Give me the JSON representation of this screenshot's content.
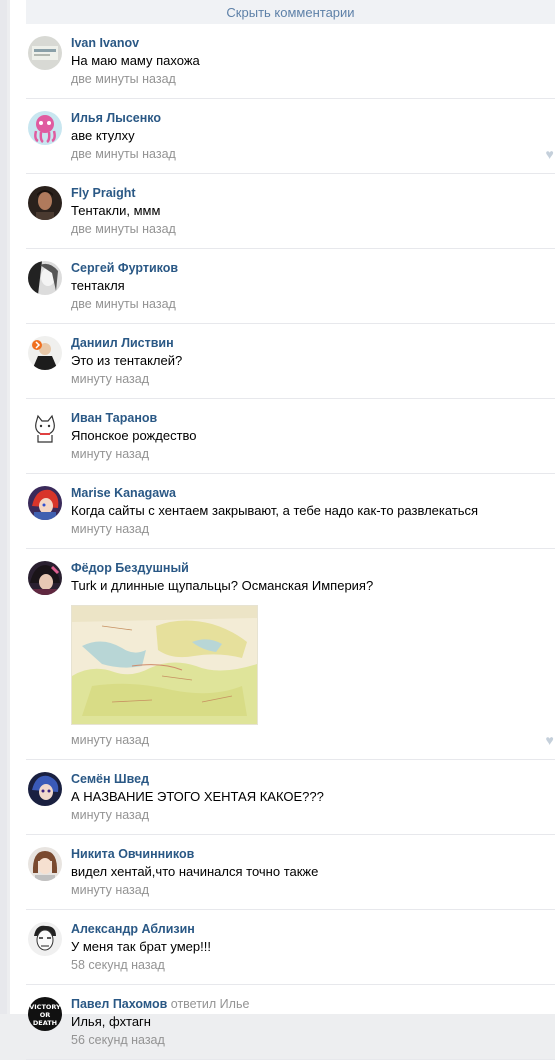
{
  "hide_comments": "Скрыть комментарии",
  "comments": [
    {
      "author": "Ivan Ivanov",
      "reply": "",
      "text": "На маю маму пахожа",
      "date": "две минуты назад",
      "likes": "",
      "avatar": "grey"
    },
    {
      "author": "Илья Лысенко",
      "reply": "",
      "text": "аве ктулху",
      "date": "две минуты назад",
      "likes": "1",
      "avatar": "octopus"
    },
    {
      "author": "Fly Praight",
      "reply": "",
      "text": "Тентакли, ммм",
      "date": "две минуты назад",
      "likes": "",
      "avatar": "dark"
    },
    {
      "author": "Сергей Фуртиков",
      "reply": "",
      "text": "тентакля",
      "date": "две минуты назад",
      "likes": "",
      "avatar": "bw"
    },
    {
      "author": "Даниил Листвин",
      "reply": "",
      "text": "Это из тентаклей?",
      "date": "минуту назад",
      "likes": "",
      "avatar": "suit"
    },
    {
      "author": "Иван Таранов",
      "reply": "",
      "text": "Японское рождество",
      "date": "минуту назад",
      "likes": "",
      "avatar": "cat"
    },
    {
      "author": "Marise Kanagawa",
      "reply": "",
      "text": "Когда сайты с хентаем закрывают, а тебе надо как-то развлекаться",
      "date": "минуту назад",
      "likes": "",
      "avatar": "anime-red"
    },
    {
      "author": "Фёдор Бездушный",
      "reply": "",
      "text": "Turk и длинные щупальцы? Османская Империя?",
      "date": "минуту назад",
      "likes": "1",
      "avatar": "anime-dark",
      "image": "map"
    },
    {
      "author": "Семён Швед",
      "reply": "",
      "text": "А НАЗВАНИЕ ЭТОГО ХЕНТАЯ КАКОЕ???",
      "date": "минуту назад",
      "likes": "",
      "avatar": "anime-blue"
    },
    {
      "author": "Никита Овчинников",
      "reply": "",
      "text": "видел хентай,что начинался точно также",
      "date": "минуту назад",
      "likes": "",
      "avatar": "anime-brown"
    },
    {
      "author": "Александр Аблизин",
      "reply": "",
      "text": "У меня так брат умер!!!",
      "date": "58 секунд назад",
      "likes": "",
      "avatar": "sketch"
    },
    {
      "author": "Павел Пахомов",
      "reply": "ответил Илье",
      "text": "Илья, фхтагн",
      "date": "56 секунд назад",
      "likes": "",
      "avatar": "victory",
      "avatar_text": [
        "VICTORY",
        "OR",
        "DEATH"
      ]
    }
  ]
}
